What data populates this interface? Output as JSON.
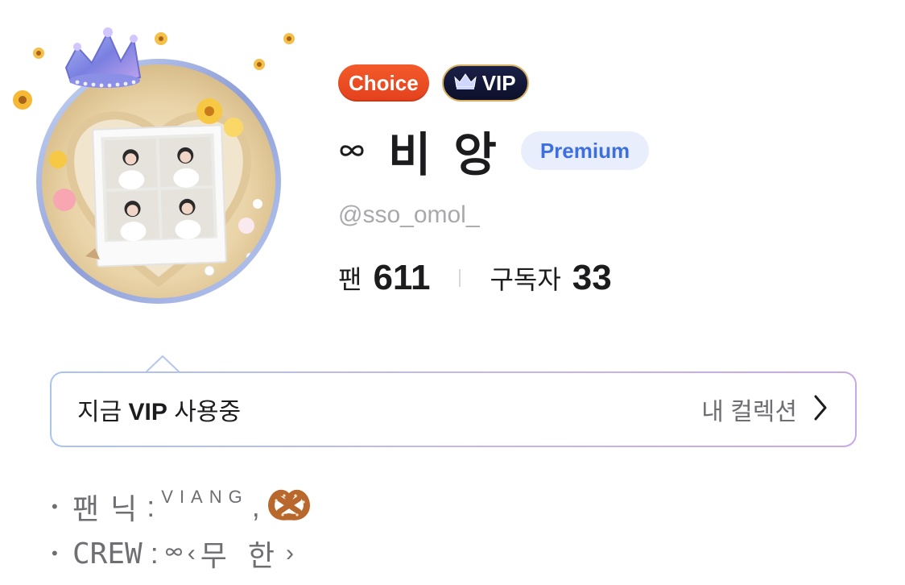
{
  "profile": {
    "badges": {
      "choice": "Choice",
      "vip": "VIP"
    },
    "name": "비 앙",
    "name_icon": "infinity-glyph",
    "tier": "Premium",
    "handle": "@sso_omol_"
  },
  "stats": {
    "fans_label": "팬",
    "fans_value": "611",
    "subscribers_label": "구독자",
    "subscribers_value": "33"
  },
  "vip_banner": {
    "prefix": "지금 ",
    "vip": "VIP",
    "suffix": " 사용중",
    "link": "내 컬렉션",
    "link_icon": "chevron-right-icon"
  },
  "bio": {
    "line1": {
      "label": "팬 닉",
      "separator": ":",
      "value": "VIANG",
      "comma": ",",
      "emoji": "pretzel"
    },
    "line2": {
      "label": "CREW",
      "separator": ":",
      "open": "‹",
      "value": "무 한",
      "close": "›"
    }
  },
  "colors": {
    "choice_badge": "#e3411d",
    "vip_badge": "#0c102a",
    "vip_badge_border": "#d9b163",
    "premium_text": "#3d6fe0",
    "premium_bg": "#e9eefc",
    "handle": "#a8a8ad"
  }
}
